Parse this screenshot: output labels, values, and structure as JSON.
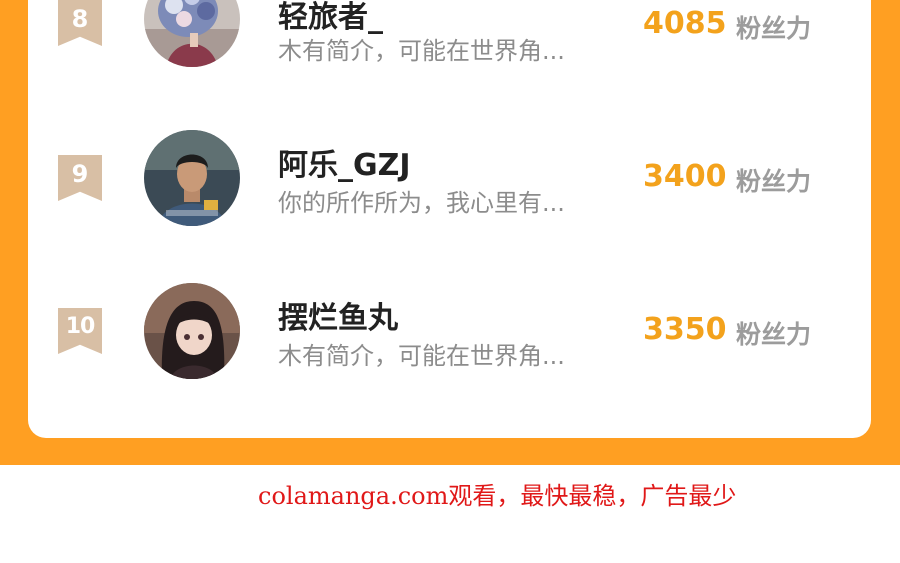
{
  "ranking": {
    "entries": [
      {
        "rank": "8",
        "name": "轻旅者_",
        "bio": "木有简介，可能在世界角...",
        "fans": "4085",
        "fans_unit": "粉丝力",
        "avatar": "avatar-flowers-portrait"
      },
      {
        "rank": "9",
        "name": "阿乐_GZJ",
        "bio": "你的所作所为，我心里有...",
        "fans": "3400",
        "fans_unit": "粉丝力",
        "avatar": "avatar-man-photo"
      },
      {
        "rank": "10",
        "name": "摆烂鱼丸",
        "bio": "木有简介，可能在世界角...",
        "fans": "3350",
        "fans_unit": "粉丝力",
        "avatar": "avatar-anime-girl"
      }
    ]
  },
  "footer": {
    "watermark": "colamanga.com观看，最快最稳，广告最少"
  },
  "colors": {
    "frame": "#ff9f22",
    "count": "#f3a21c",
    "badge": "#d8bfa5",
    "watermark": "#e01818"
  }
}
